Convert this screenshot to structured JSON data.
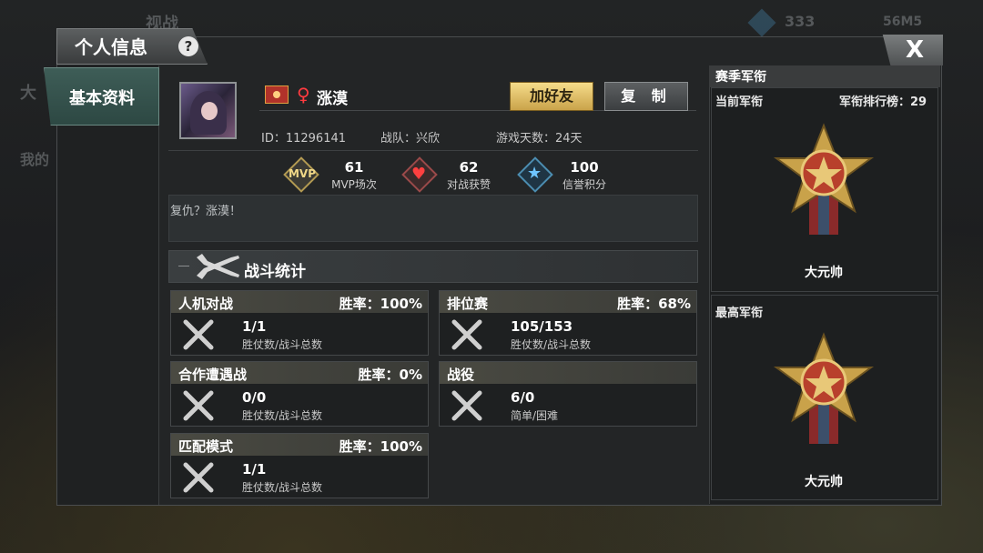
{
  "background": {
    "left_text_1": "大",
    "left_text_2": "我的",
    "top_text": "视战",
    "currency": "333",
    "status": "56M5"
  },
  "window": {
    "title": "个人信息",
    "help_label": "?",
    "close_label": "X"
  },
  "nav": {
    "items": [
      {
        "label": "基本资料",
        "active": true
      }
    ]
  },
  "profile": {
    "name": "涨漠",
    "id_text": "ID：11296141",
    "team_text": "战队：兴欣",
    "days_text": "游戏天数：24天",
    "add_friend_label": "加好友",
    "copy_label": "复 制",
    "signature": "复仇？涨漠！"
  },
  "kpis": [
    {
      "icon": "mvp-icon",
      "icon_text": "MVP",
      "value": "61",
      "label": "MVP场次"
    },
    {
      "icon": "heart-icon",
      "value": "62",
      "label": "对战获赞"
    },
    {
      "icon": "star-icon",
      "value": "100",
      "label": "信誉积分"
    }
  ],
  "battle_stats": {
    "title": "战斗统计",
    "cards": [
      {
        "title": "人机对战",
        "rate": "胜率：100%",
        "value": "1/1",
        "sub": "胜仗数/战斗总数"
      },
      {
        "title": "排位赛",
        "rate": "胜率：68%",
        "value": "105/153",
        "sub": "胜仗数/战斗总数"
      },
      {
        "title": "合作遭遇战",
        "rate": "胜率：0%",
        "value": "0/0",
        "sub": "胜仗数/战斗总数"
      },
      {
        "title": "战役",
        "rate": "",
        "value": "6/0",
        "sub": "简单/困难"
      },
      {
        "title": "匹配模式",
        "rate": "胜率：100%",
        "value": "1/1",
        "sub": "胜仗数/战斗总数"
      }
    ]
  },
  "ranks": {
    "title": "赛季军衔",
    "current_label": "当前军衔",
    "leaderboard": "军衔排行榜：29",
    "current_rank": "大元帅",
    "highest_label": "最高军衔",
    "highest_rank": "大元帅"
  },
  "colors": {
    "accent_gold": "#caa34a",
    "heart_red": "#ff4040",
    "star_blue": "#6fc5ff",
    "nav_teal": "#3e5d57"
  }
}
